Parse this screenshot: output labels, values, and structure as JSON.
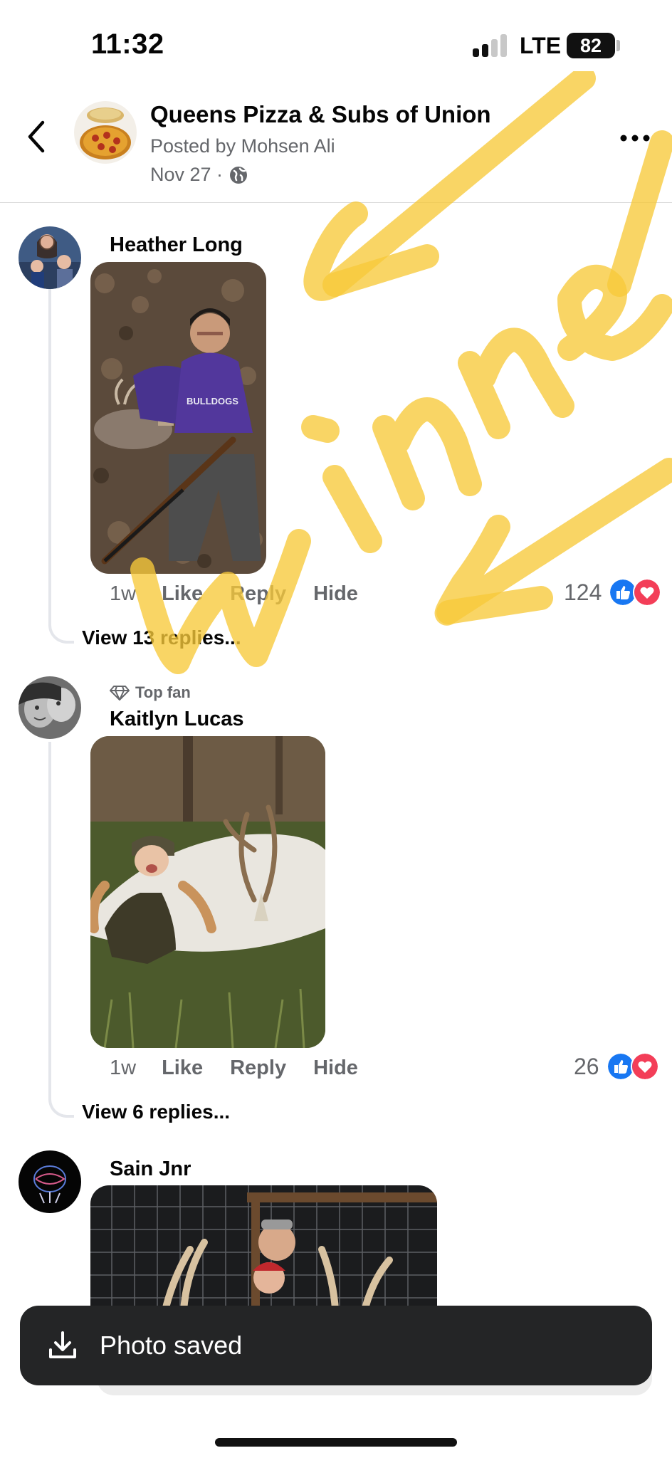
{
  "status_bar": {
    "time": "11:32",
    "network": "LTE",
    "battery": "82"
  },
  "header": {
    "page_name": "Queens Pizza & Subs of Union",
    "posted_by": "Posted by Mohsen Ali",
    "date": "Nov 27 ·"
  },
  "comments": [
    {
      "author": "Heather Long",
      "age": "1w",
      "like": "Like",
      "reply": "Reply",
      "hide": "Hide",
      "reaction_count": "124",
      "view_replies": "View 13 replies..."
    },
    {
      "badge": "Top fan",
      "author": "Kaitlyn Lucas",
      "age": "1w",
      "like": "Like",
      "reply": "Reply",
      "hide": "Hide",
      "reaction_count": "26",
      "view_replies": "View 6 replies..."
    },
    {
      "author": "Sain Jnr"
    }
  ],
  "toast": {
    "text": "Photo saved"
  },
  "colors": {
    "like_blue": "#1877f2",
    "love_red": "#f33e58",
    "marker_yellow": "#f7c93a",
    "toast_bg": "#242526"
  },
  "icons": [
    "back-arrow-icon",
    "globe-icon",
    "more-icon",
    "diamond-icon",
    "like-reaction-icon",
    "love-reaction-icon",
    "download-icon"
  ]
}
